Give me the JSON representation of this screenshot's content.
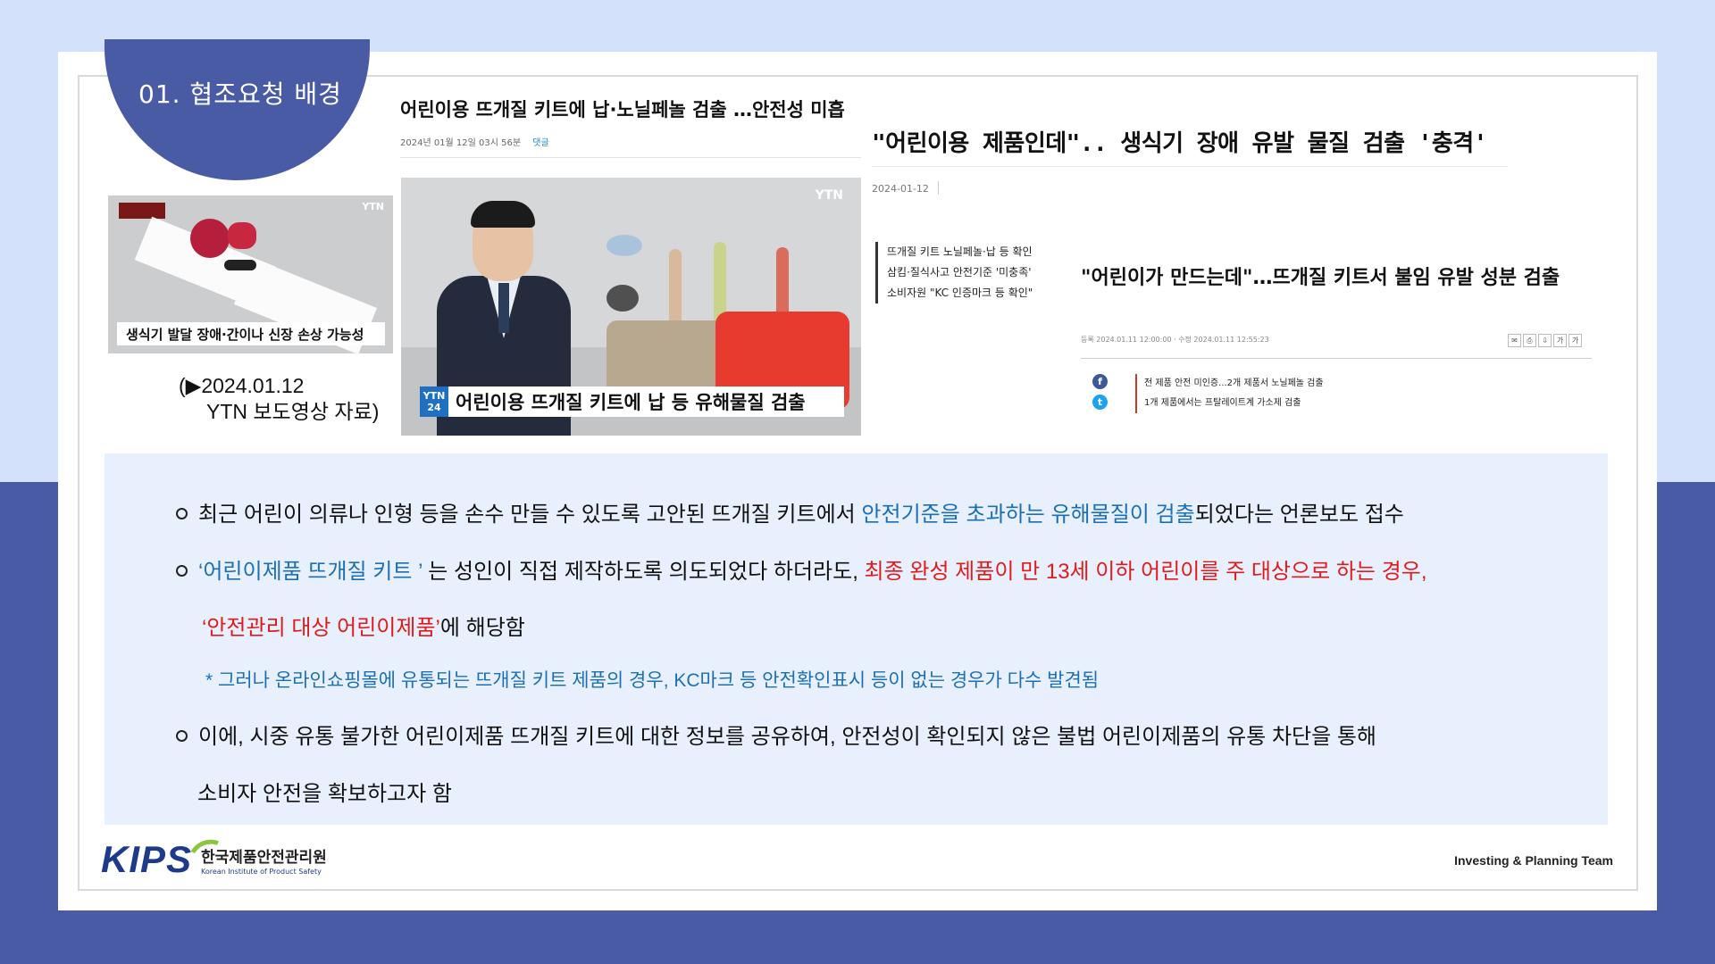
{
  "section_title": "01. 협조요청 배경",
  "thumbnail": {
    "caption_overlay": "생식기 발달 장애·간이나 신장 손상 가능성",
    "broadcaster": "YTN",
    "caption_line1": "(▶2024.01.12",
    "caption_line2": "YTN 보도영상 자료)"
  },
  "article1": {
    "headline": "어린이용 뜨개질 키트에 납·노닐페놀 검출 …안전성 미흡",
    "date": "2024년 01월 12일 03시 56분",
    "comments": "댓글",
    "video_logo": "YTN",
    "badge": "YTN 24",
    "lower_third": "어린이용 뜨개질 키트에 납 등 유해물질 검출"
  },
  "article2": {
    "headline": "\"어린이용 제품인데\".. 생식기 장애 유발 물질 검출 '충격'",
    "date": "2024-01-12",
    "summary": [
      "뜨개질 키트 노닐페놀·납 등 확인",
      "삼킴·질식사고 안전기준 '미충족'",
      "소비자원 \"KC 인증마크 등 확인\""
    ]
  },
  "article3": {
    "headline": "\"어린이가 만드는데\"…뜨개질 키트서 불임 유발 성분 검출",
    "meta": "등록 2024.01.11 12:00:00 · 수정 2024.01.11 12:55:23",
    "tools": [
      "✉",
      "⎙",
      "⇩",
      "가",
      "가"
    ],
    "summary": [
      "전 제품 안전 미인증...2개 제품서 노닐페놀 검출",
      "1개 제품에서는 프탈레이트계 가소제 검출"
    ],
    "social": [
      "f",
      "t"
    ]
  },
  "body": {
    "p1_a": "최근 어린이 의류나 인형 등을 손수 만들 수 있도록 고안된 뜨개질 키트에서 ",
    "p1_blue": "안전기준을 초과하는 유해물질이 검출",
    "p1_b": "되었다는 언론보도 접수",
    "p2_blue": "‘어린이제품 뜨개질 키트 ’",
    "p2_a": " 는 성인이 직접 제작하도록 의도되었다 하더라도, ",
    "p2_red": "최종 완성 제품이 만 13세 이하 어린이를 주 대상으로 하는 경우,",
    "p3_red": "‘안전관리 대상 어린이제품’",
    "p3_a": "에 해당함",
    "note": "* 그러나 온라인쇼핑몰에 유통되는 뜨개질 키트 제품의 경우, KC마크 등 안전확인표시 등이 없는 경우가 다수 발견됨",
    "p4": "이에, 시중 유통 불가한 어린이제품 뜨개질 키트에 대한 정보를 공유하여, 안전성이 확인되지 않은 불법 어린이제품의 유통 차단을 통해",
    "p5": "소비자 안전을 확보하고자 함"
  },
  "footer": {
    "logo_word": "KIPS",
    "org_ko": "한국제품안전관리원",
    "org_en": "Korean Institute of Product Safety",
    "team": "Investing & Planning Team"
  },
  "colors": {
    "accent": "#4a5ba6",
    "light_bg": "#d3e2fa",
    "content_bg": "#e9f0fd",
    "blue_text": "#1b6fb5",
    "red_text": "#e01b1b"
  }
}
